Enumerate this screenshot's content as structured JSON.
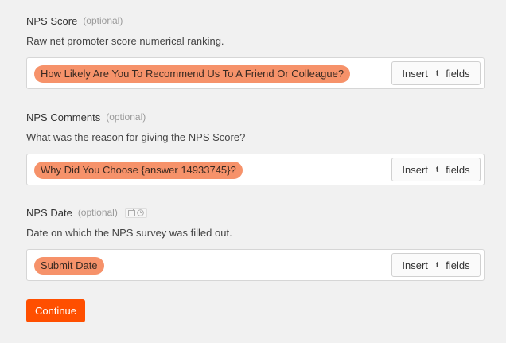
{
  "fields": [
    {
      "label": "NPS Score",
      "optional": "(optional)",
      "description": "Raw net promoter score numerical ranking.",
      "value": "How Likely Are You To Recommend Us To A Friend Or Colleague?"
    },
    {
      "label": "NPS Comments",
      "optional": "(optional)",
      "description": "What was the reason for giving the NPS Score?",
      "value": "Why Did You Choose {answer 14933745}?"
    },
    {
      "label": "NPS Date",
      "optional": "(optional)",
      "description": "Date on which the NPS survey was filled out.",
      "value": "Submit Date"
    }
  ],
  "insert": {
    "left": "Insert",
    "icon_letter": "t",
    "right": "fields"
  },
  "continue_label": "Continue",
  "colors": {
    "pill": "#f6926a",
    "accent": "#ff4f00"
  },
  "icons": [
    "calendar-icon",
    "clock-icon"
  ]
}
